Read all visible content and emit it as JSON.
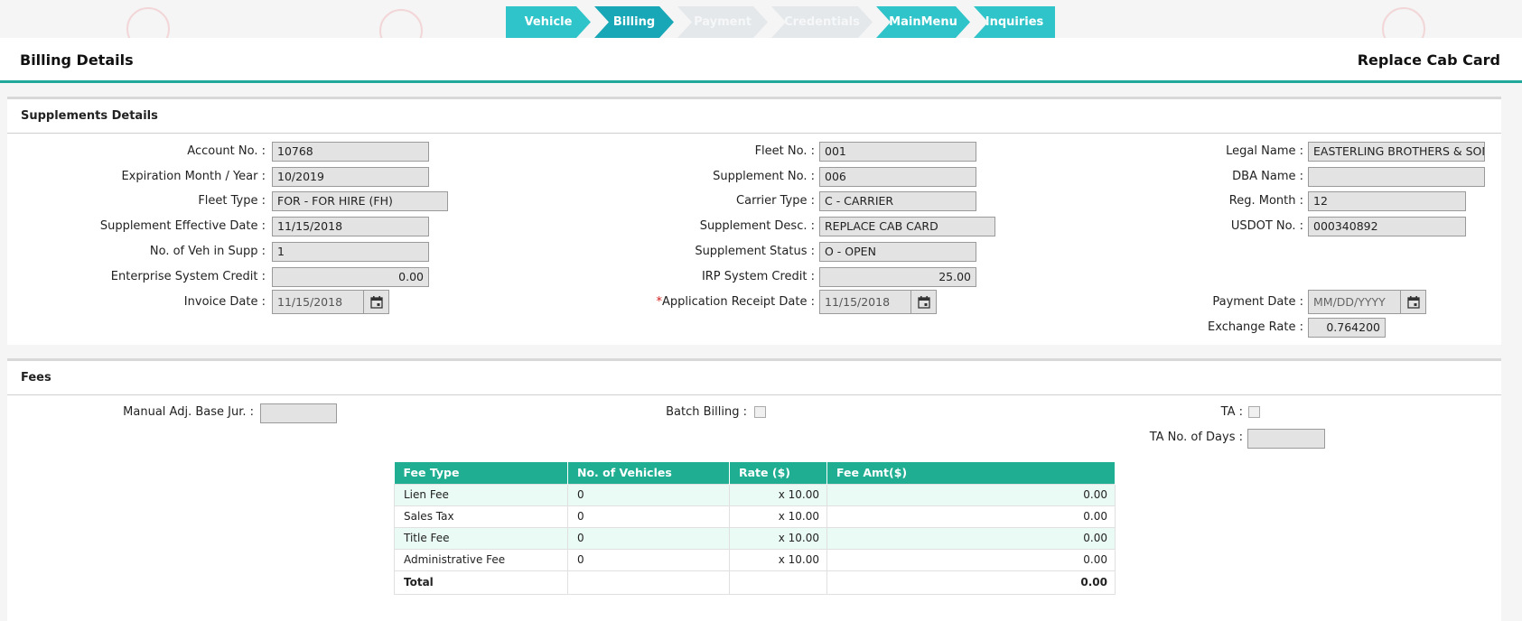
{
  "steps": [
    {
      "label": "Vehicle",
      "state": "done"
    },
    {
      "label": "Billing",
      "state": "active"
    },
    {
      "label": "Payment",
      "state": "disabled"
    },
    {
      "label": "Credentials",
      "state": "disabled"
    },
    {
      "label": "MainMenu",
      "state": "done"
    },
    {
      "label": "Inquiries",
      "state": "done"
    }
  ],
  "header": {
    "title": "Billing Details",
    "action": "Replace Cab Card"
  },
  "supplements": {
    "heading": "Supplements Details",
    "account_no": {
      "label": "Account No. :",
      "value": "10768"
    },
    "expiration": {
      "label": "Expiration Month / Year :",
      "value": "10/2019"
    },
    "fleet_type": {
      "label": "Fleet Type :",
      "value": "FOR - FOR HIRE (FH)"
    },
    "effective_date": {
      "label": "Supplement Effective Date :",
      "value": "11/15/2018"
    },
    "veh_in_supp": {
      "label": "No. of Veh in Supp :",
      "value": "1"
    },
    "enterprise_credit": {
      "label": "Enterprise System Credit :",
      "value": "0.00"
    },
    "invoice_date": {
      "label": "Invoice Date :",
      "value": "11/15/2018"
    },
    "fleet_no": {
      "label": "Fleet No. :",
      "value": "001"
    },
    "supplement_no": {
      "label": "Supplement No. :",
      "value": "006"
    },
    "carrier_type": {
      "label": "Carrier Type :",
      "value": "C - CARRIER"
    },
    "supplement_desc": {
      "label": "Supplement Desc. :",
      "value": "REPLACE CAB CARD"
    },
    "supplement_status": {
      "label": "Supplement Status :",
      "value": "O - OPEN"
    },
    "irp_credit": {
      "label": "IRP System Credit :",
      "value": "25.00"
    },
    "app_receipt_date": {
      "required": "*",
      "label": "Application Receipt Date :",
      "value": "11/15/2018"
    },
    "legal_name": {
      "label": "Legal Name :",
      "value": "EASTERLING BROTHERS & SON"
    },
    "dba_name": {
      "label": "DBA Name :",
      "value": ""
    },
    "reg_month": {
      "label": "Reg. Month :",
      "value": "12"
    },
    "usdot_no": {
      "label": "USDOT No. :",
      "value": "000340892"
    },
    "payment_date": {
      "label": "Payment Date :",
      "placeholder": "MM/DD/YYYY"
    },
    "exchange_rate": {
      "label": "Exchange Rate :",
      "value": "0.764200"
    }
  },
  "fees": {
    "heading": "Fees",
    "manual_adj": {
      "label": "Manual Adj. Base Jur. :",
      "value": ""
    },
    "batch_billing": {
      "label": "Batch Billing :",
      "checked": false
    },
    "ta": {
      "label": "TA :",
      "checked": false
    },
    "ta_days": {
      "label": "TA No. of Days :",
      "value": ""
    },
    "table": {
      "headers": [
        "Fee Type",
        "No. of Vehicles",
        "Rate ($)",
        "Fee Amt($)"
      ],
      "rows": [
        [
          "Lien Fee",
          "0",
          "x 10.00",
          "0.00"
        ],
        [
          "Sales Tax",
          "0",
          "x 10.00",
          "0.00"
        ],
        [
          "Title Fee",
          "0",
          "x 10.00",
          "0.00"
        ],
        [
          "Administrative Fee",
          "0",
          "x 10.00",
          "0.00"
        ]
      ],
      "total_label": "Total",
      "total_value": "0.00"
    }
  }
}
